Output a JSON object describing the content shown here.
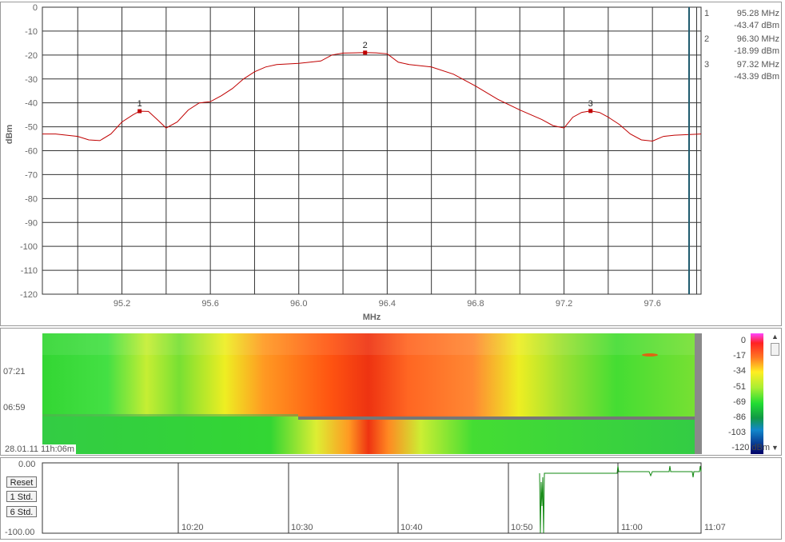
{
  "spectrum": {
    "y_axis_label": "dBm",
    "x_axis_label": "MHz",
    "y_ticks": [
      "0",
      "-10",
      "-20",
      "-30",
      "-40",
      "-50",
      "-60",
      "-70",
      "-80",
      "-90",
      "-100",
      "-110",
      "-120"
    ],
    "x_ticks": [
      "95.2",
      "95.6",
      "96.0",
      "96.4",
      "96.8",
      "97.2",
      "97.6"
    ],
    "markers": [
      {
        "id": "1",
        "freq": "95.28 MHz",
        "level": "-43.47 dBm"
      },
      {
        "id": "2",
        "freq": "96.30 MHz",
        "level": "-18.99 dBm"
      },
      {
        "id": "3",
        "freq": "97.32 MHz",
        "level": "-43.39 dBm"
      }
    ],
    "colors": {
      "trace": "#c00000",
      "grid": "#333333",
      "cursor": "#1f5b6e",
      "marker": "#c00000"
    }
  },
  "chart_data": {
    "type": "line",
    "title": "",
    "xlabel": "MHz",
    "ylabel": "dBm",
    "xlim": [
      94.84,
      97.82
    ],
    "ylim": [
      -120,
      0
    ],
    "grid": true,
    "series": [
      {
        "x": [
          94.84,
          94.9,
          95.0,
          95.05,
          95.1,
          95.15,
          95.2,
          95.25,
          95.28,
          95.32,
          95.36,
          95.4,
          95.45,
          95.5,
          95.55,
          95.6,
          95.65,
          95.7,
          95.75,
          95.8,
          95.85,
          95.9,
          96.0,
          96.1,
          96.15,
          96.2,
          96.25,
          96.3,
          96.35,
          96.4,
          96.45,
          96.5,
          96.6,
          96.7,
          96.8,
          96.9,
          97.0,
          97.1,
          97.15,
          97.2,
          97.24,
          97.28,
          97.32,
          97.36,
          97.4,
          97.45,
          97.5,
          97.55,
          97.6,
          97.65,
          97.7,
          97.82
        ],
        "y": [
          -53,
          -53,
          -54,
          -55.5,
          -55.8,
          -53,
          -48,
          -45,
          -43.5,
          -43.6,
          -47,
          -50.5,
          -48,
          -43,
          -40,
          -39.5,
          -37,
          -34,
          -30,
          -27,
          -25,
          -24,
          -23.5,
          -22.5,
          -20,
          -19.2,
          -19.1,
          -19,
          -19.1,
          -19.5,
          -23,
          -24,
          -25,
          -28,
          -33,
          -38.5,
          -43,
          -47,
          -49.5,
          -50.5,
          -46,
          -44,
          -43.4,
          -44,
          -46,
          -49,
          -53,
          -55.5,
          -56,
          -54,
          -53.5,
          -53
        ]
      }
    ]
  },
  "waterfall": {
    "time_labels": [
      "07:21",
      "06:59"
    ],
    "timestamp": "28.01.11 11h:06m",
    "scale_ticks": [
      "0",
      "-17",
      "-34",
      "-51",
      "-69",
      "-86",
      "-103",
      "-120 dBm"
    ]
  },
  "history": {
    "y_ticks": [
      "0.00",
      "-100.00"
    ],
    "x_ticks": [
      "10:20",
      "10:30",
      "10:40",
      "10:50",
      "11:00",
      "11:07"
    ],
    "buttons": {
      "reset": "Reset",
      "std1": "1 Std.",
      "std6": "6 Std."
    }
  }
}
